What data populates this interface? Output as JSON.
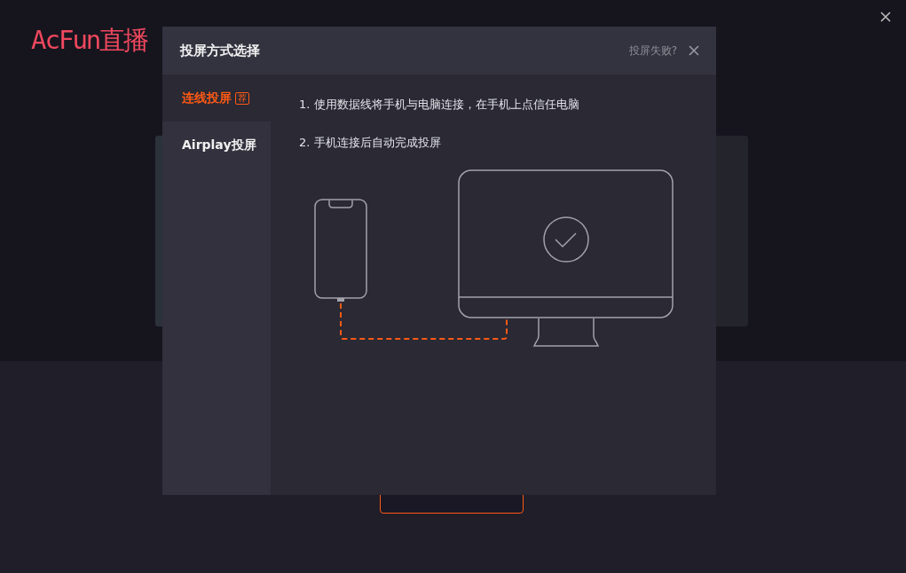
{
  "app": {
    "logo": "AcFun直播"
  },
  "dialog": {
    "title": "投屏方式选择",
    "help_link": "投屏失败?",
    "tabs": [
      {
        "label": "连线投屏",
        "badge": "荐",
        "selected": true
      },
      {
        "label": "Airplay投屏",
        "selected": false
      }
    ],
    "steps": [
      "1. 使用数据线将手机与电脑连接，在手机上点信任电脑",
      "2. 手机连接后自动完成投屏"
    ]
  }
}
